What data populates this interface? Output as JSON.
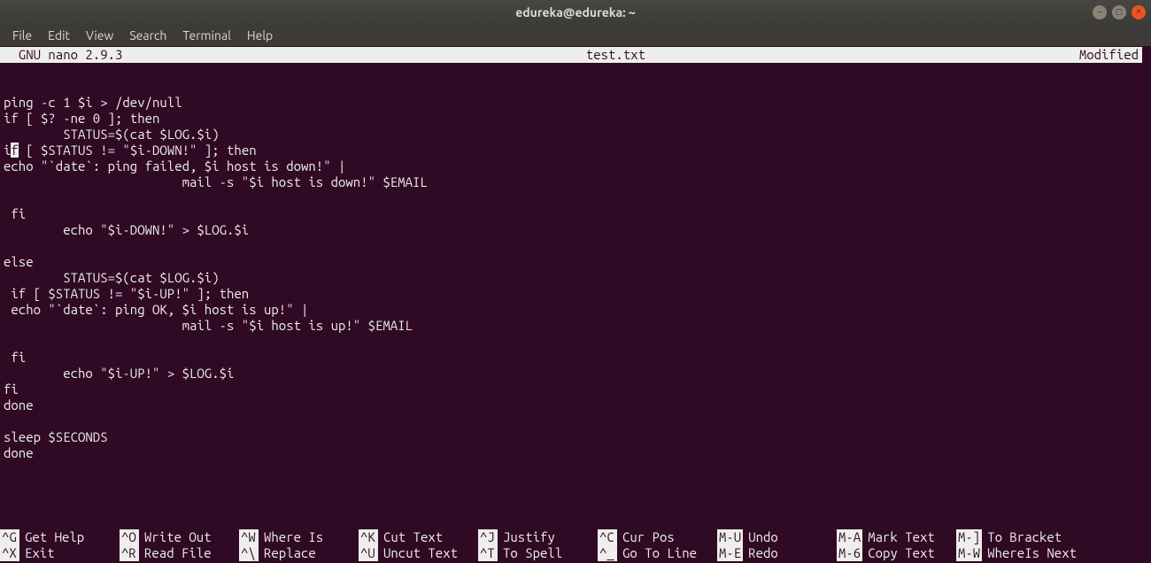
{
  "window": {
    "title": "edureka@edureka: ~"
  },
  "menubar": [
    "File",
    "Edit",
    "View",
    "Search",
    "Terminal",
    "Help"
  ],
  "nano": {
    "version": "  GNU nano 2.9.3    ",
    "filename": "test.txt",
    "modified": "Modified"
  },
  "content": {
    "lines": [
      "",
      "ping -c 1 $i > /dev/null",
      "if [ $? -ne 0 ]; then",
      "        STATUS=$(cat $LOG.$i)",
      {
        "pre": "i",
        "caret": "f",
        "post": " [ $STATUS != \"$i-DOWN!\" ]; then"
      },
      "echo \"`date`: ping failed, $i host is down!\" |",
      "                        mail -s \"$i host is down!\" $EMAIL",
      "",
      " fi",
      "        echo \"$i-DOWN!\" > $LOG.$i",
      "",
      "else",
      "        STATUS=$(cat $LOG.$i)",
      " if [ $STATUS != \"$i-UP!\" ]; then",
      " echo \"`date`: ping OK, $i host is up!\" |",
      "                        mail -s \"$i host is up!\" $EMAIL",
      "",
      " fi",
      "        echo \"$i-UP!\" > $LOG.$i",
      "fi",
      "done",
      "",
      "sleep $SECONDS",
      "done"
    ]
  },
  "shortcuts": {
    "row1": [
      {
        "key": "^G",
        "desc": "Get Help"
      },
      {
        "key": "^O",
        "desc": "Write Out"
      },
      {
        "key": "^W",
        "desc": "Where Is"
      },
      {
        "key": "^K",
        "desc": "Cut Text"
      },
      {
        "key": "^J",
        "desc": "Justify"
      },
      {
        "key": "^C",
        "desc": "Cur Pos"
      },
      {
        "key": "M-U",
        "desc": "Undo"
      },
      {
        "key": "M-A",
        "desc": "Mark Text"
      },
      {
        "key": "M-]",
        "desc": "To Bracket"
      }
    ],
    "row2": [
      {
        "key": "^X",
        "desc": "Exit"
      },
      {
        "key": "^R",
        "desc": "Read File"
      },
      {
        "key": "^\\",
        "desc": "Replace"
      },
      {
        "key": "^U",
        "desc": "Uncut Text"
      },
      {
        "key": "^T",
        "desc": "To Spell"
      },
      {
        "key": "^_",
        "desc": "Go To Line"
      },
      {
        "key": "M-E",
        "desc": "Redo"
      },
      {
        "key": "M-6",
        "desc": "Copy Text"
      },
      {
        "key": "M-W",
        "desc": "WhereIs Next"
      }
    ]
  }
}
